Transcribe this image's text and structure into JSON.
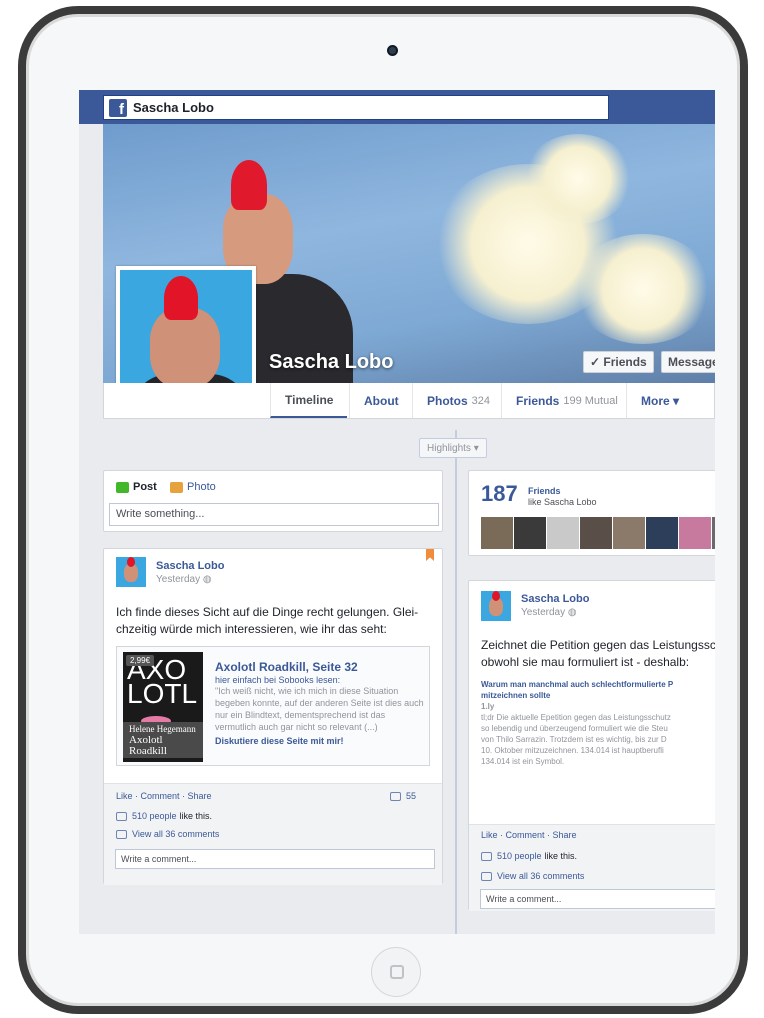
{
  "window": {
    "search_name": "Sascha Lobo"
  },
  "profile": {
    "name": "Sascha Lobo",
    "friends_button": "✓ Friends",
    "message_button": "Message"
  },
  "tabs": [
    {
      "label": "Timeline",
      "count": ""
    },
    {
      "label": "About",
      "count": ""
    },
    {
      "label": "Photos",
      "count": "324"
    },
    {
      "label": "Friends",
      "count": "199 Mutual"
    },
    {
      "label": "More ▾",
      "count": ""
    }
  ],
  "highlights": "Highlights ▾",
  "composer": {
    "post_tab": "Post",
    "photo_tab": "Photo",
    "placeholder": "Write something..."
  },
  "friends_box": {
    "count": "187",
    "label": "Friends",
    "sub": "like Sascha Lobo"
  },
  "post1": {
    "author": "Sascha Lobo",
    "date": "Yesterday",
    "text_line1": "Ich finde dieses Sicht auf die Dinge recht gelungen. Glei-",
    "text_line2": "chzeitig würde mich interessieren, wie ihr das seht:",
    "attachment": {
      "price": "2,99€",
      "book_title": "AXO LOTL",
      "book_author": "Helene Hegemann",
      "book_subtitle1": "Axolotl",
      "book_subtitle2": "Roadkill",
      "title": "Axolotl Roadkill, Seite 32",
      "subtitle": "hier einfach bei Sobooks lesen:",
      "description": "\"Ich weiß nicht, wie ich mich in diese Situation begeben konnte, auf der anderen Seite ist dies auch nur ein Blindtext, dementsprechend ist das vermutlich auch gar nicht so relevant (...)",
      "link": "Diskutiere diese Seite mit mir!"
    },
    "actions": "Like · Comment · Share",
    "comment_count": "55",
    "likes_link": "510 people",
    "likes_text": "like this.",
    "view_comments": "View all 36 comments",
    "comment_placeholder": "Write a comment..."
  },
  "post2": {
    "author": "Sascha Lobo",
    "date": "Yesterday",
    "text_line1": "Zeichnet die Petition gegen das Leistungssch",
    "text_line2": "obwohl sie mau formuliert ist - deshalb:",
    "link_title1": "Warum man manchmal auch schlechtformulierte P",
    "link_title2": "mitzeichnen sollte",
    "link_domain": "1.ly",
    "link_desc1": "tl;dr Die aktuelle Epetition gegen das Leistungsschutz",
    "link_desc2": "so lebendig und überzeugend formuliert wie die Steu",
    "link_desc3": "von Thilo Sarrazin. Trotzdem ist es wichtig, bis zur D",
    "link_desc4": "10. Oktober mitzuzeichnen. 134.014 ist hauptberufli",
    "link_desc5": "134.014 ist ein Symbol.",
    "actions": "Like · Comment · Share",
    "likes_link": "510 people",
    "likes_text": "like this.",
    "view_comments": "View all 36 comments",
    "comment_placeholder": "Write a comment..."
  },
  "colors": {
    "facebook_blue": "#3b5998",
    "link_blue": "#3b5998",
    "page_bg": "#e9ebee",
    "mohawk_red": "#e01a2c"
  }
}
